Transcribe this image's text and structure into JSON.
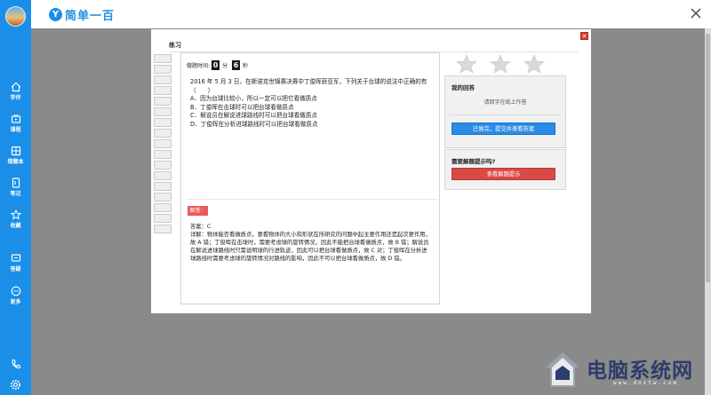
{
  "app": {
    "logo_mark": "Y",
    "name": "简单一百"
  },
  "sidebar": {
    "items": [
      {
        "label": "学伴",
        "icon": "home-icon"
      },
      {
        "label": "课程",
        "icon": "tv-icon"
      },
      {
        "label": "错题本",
        "icon": "grid-book-icon"
      },
      {
        "label": "笔记",
        "icon": "notebook-icon"
      },
      {
        "label": "收藏",
        "icon": "star-icon"
      },
      {
        "label": "答疑",
        "icon": "chat-icon"
      },
      {
        "label": "更多",
        "icon": "more-icon"
      }
    ],
    "bottom_icons": [
      "phone-icon",
      "gear-icon"
    ]
  },
  "modal": {
    "title": "练习",
    "close_label": "✕",
    "timer": {
      "label": "做题时间:",
      "minutes": "0",
      "minute_unit": "分",
      "seconds": "6",
      "second_unit": "秒"
    },
    "rating_stars": 3,
    "question": {
      "stem": "2016 年 5 月 3 日，在斯诺克世锦赛决赛中丁俊晖获亚军，下列关于台球的说法中正确的有（　　）",
      "options": [
        "A．因为台球比较小，所以一定可以把它看做质点",
        "B．丁俊晖在击球时可以把台球看做质点",
        "C．解说员在解说进球路线时可以把台球看做质点",
        "D．丁俊晖在分析进球路线时可以把台球看做质点"
      ]
    },
    "analysis": {
      "tag": "解答：",
      "answer": "答案：C",
      "detail": "详解：物体能否看做质点，要看物体的大小和形状在所研究的问题中起主要作用还是起次要作用，故 A 错；丁俊晖在击球时，需要考虑球的旋转情况，因此不能把台球看做质点，故 B 错；解说员在解说进球路线时只需说明球的行进轨迹，因此可以把台球看做质点，故 C 对；丁俊晖在分析进球路线时需要考虑球的旋转情况对路线的影响，因此不可以把台球看做质点，故 D 错。"
    },
    "my_answer_panel": {
      "title": "我的回答",
      "note": "请回字在纸上作答",
      "button": "已做完，提交并查看答案"
    },
    "hint_panel": {
      "title": "需要解题提示吗?",
      "button": "查看解题提示"
    }
  },
  "watermark": {
    "title": "电脑系统网",
    "url": "www.dnxtw.com"
  },
  "colors": {
    "sidebar": "#1b8fe8",
    "backdrop": "#8a8a8a",
    "primary_button": "#2b8ce6",
    "danger_button": "#d94a46",
    "close_button": "#d9382d"
  }
}
